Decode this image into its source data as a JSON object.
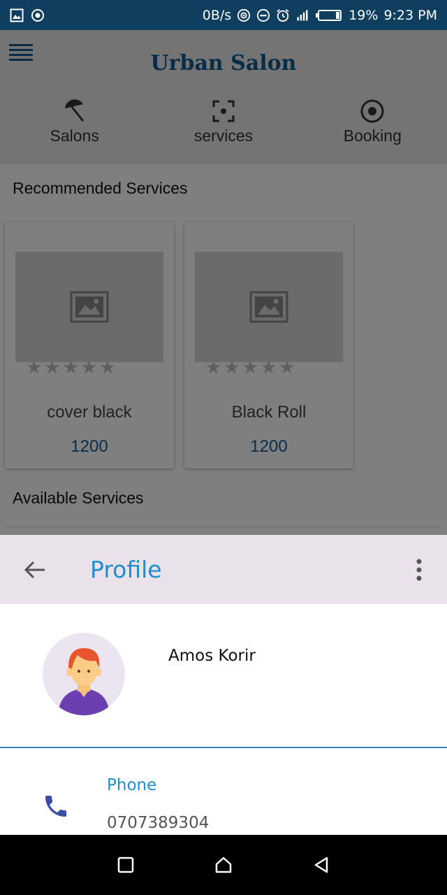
{
  "status_bar": {
    "net_speed": "0B/s",
    "battery": "19%",
    "time": "9:23 PM"
  },
  "app": {
    "title": "Urban Salon",
    "tabs": [
      {
        "label": "Salons",
        "icon": "umbrella-icon"
      },
      {
        "label": "services",
        "icon": "focus-icon"
      },
      {
        "label": "Booking",
        "icon": "radio-icon"
      }
    ],
    "recommended_title": "Recommended Services",
    "cards": [
      {
        "name": "cover black",
        "price": "1200",
        "rating_stars": 0
      },
      {
        "name": "Black Roll",
        "price": "1200",
        "rating_stars": 0
      }
    ],
    "available_title": "Available Services"
  },
  "profile": {
    "title": "Profile",
    "name": "Amos Korir",
    "phone_label": "Phone",
    "phone_value": "0707389304"
  },
  "colors": {
    "accent": "#1d8fce",
    "brand": "#135a8f",
    "status_bar": "#0f3e5e",
    "sheet_header": "#e9e2eb"
  }
}
